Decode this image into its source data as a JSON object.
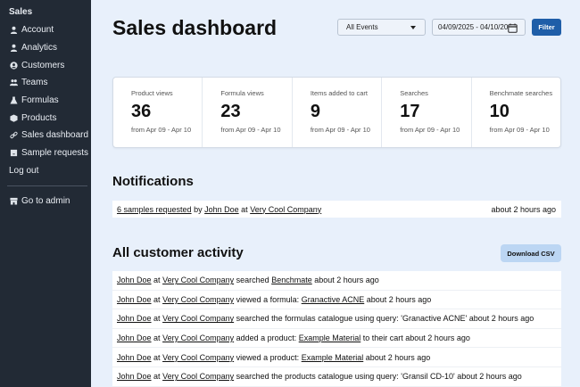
{
  "sidebar": {
    "title": "Sales",
    "items": [
      {
        "label": "Account",
        "icon": "user-icon"
      },
      {
        "label": "Analytics",
        "icon": "user-icon"
      },
      {
        "label": "Customers",
        "icon": "user-circle-icon"
      },
      {
        "label": "Teams",
        "icon": "users-icon"
      },
      {
        "label": "Formulas",
        "icon": "flask-icon"
      },
      {
        "label": "Products",
        "icon": "box-icon"
      },
      {
        "label": "Sales dashboard",
        "icon": "link-icon"
      },
      {
        "label": "Sample requests",
        "icon": "inbox-icon"
      }
    ],
    "logout": "Log out",
    "admin": "Go to admin"
  },
  "header": {
    "title": "Sales dashboard",
    "event_select": "All Events",
    "date_range": "04/09/2025 - 04/10/2025",
    "filter_label": "Filter"
  },
  "stats": [
    {
      "label": "Product views",
      "value": "36",
      "range": "from Apr 09 - Apr 10"
    },
    {
      "label": "Formula views",
      "value": "23",
      "range": "from Apr 09 - Apr 10"
    },
    {
      "label": "Items added to cart",
      "value": "9",
      "range": "from Apr 09 - Apr 10"
    },
    {
      "label": "Searches",
      "value": "17",
      "range": "from Apr 09 - Apr 10"
    },
    {
      "label": "Benchmate searches",
      "value": "10",
      "range": "from Apr 09 - Apr 10"
    }
  ],
  "notifications": {
    "title": "Notifications",
    "items": [
      {
        "samples": "6 samples requested",
        "by": "by",
        "user": "John Doe",
        "at": "at",
        "company": "Very Cool Company",
        "time": "about 2 hours ago"
      }
    ]
  },
  "activity": {
    "title": "All customer activity",
    "download_label": "Download CSV",
    "rows": [
      {
        "user": "John Doe",
        "at": "at",
        "company": "Very Cool Company",
        "action": "searched",
        "target": "Benchmate",
        "suffix": "about 2 hours ago"
      },
      {
        "user": "John Doe",
        "at": "at",
        "company": "Very Cool Company",
        "action": "viewed a formula:",
        "target": "Granactive ACNE",
        "suffix": "about 2 hours ago"
      },
      {
        "user": "John Doe",
        "at": "at",
        "company": "Very Cool Company",
        "action": "searched the formulas catalogue using query: 'Granactive ACNE' about 2 hours ago",
        "target": "",
        "suffix": ""
      },
      {
        "user": "John Doe",
        "at": "at",
        "company": "Very Cool Company",
        "action": "added a product:",
        "target": "Example Material",
        "suffix": "to their cart about 2 hours ago"
      },
      {
        "user": "John Doe",
        "at": "at",
        "company": "Very Cool Company",
        "action": "viewed a product:",
        "target": "Example Material",
        "suffix": "about 2 hours ago"
      },
      {
        "user": "John Doe",
        "at": "at",
        "company": "Very Cool Company",
        "action": "searched the products catalogue using query: 'Gransil CD-10' about 2 hours ago",
        "target": "",
        "suffix": ""
      }
    ]
  }
}
